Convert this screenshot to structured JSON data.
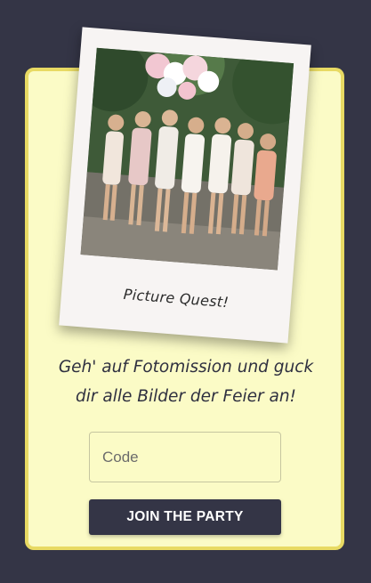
{
  "colors": {
    "background": "#343546",
    "card_fill": "#fbfbc6",
    "card_border": "#e8da63",
    "polaroid": "#f7f4f3",
    "button": "#343546",
    "button_text": "#ffffff",
    "text": "#2f3040"
  },
  "polaroid": {
    "caption": "Picture Quest!",
    "photo_description_icon": "group-photo-image"
  },
  "intro": {
    "line1": "Geh' auf Fotomission und guck",
    "line2": "dir alle Bilder der Feier an!"
  },
  "form": {
    "code_placeholder": "Code",
    "code_value": "",
    "join_label": "JOIN THE PARTY"
  }
}
